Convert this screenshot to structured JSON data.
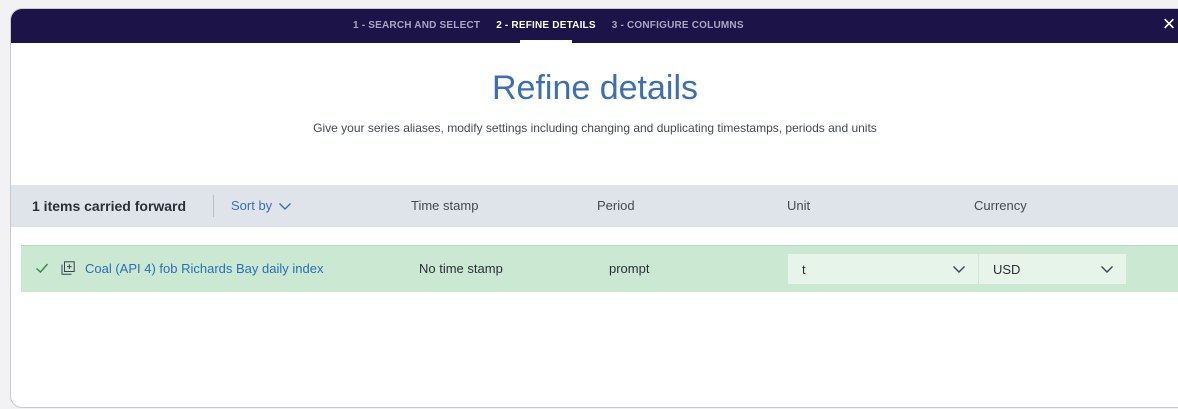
{
  "steps": [
    {
      "label": "1 - SEARCH AND SELECT",
      "active": false
    },
    {
      "label": "2 - REFINE DETAILS",
      "active": true
    },
    {
      "label": "3 - CONFIGURE COLUMNS",
      "active": false
    }
  ],
  "close_label": "×",
  "page": {
    "title": "Refine details",
    "subtitle": "Give your series aliases, modify settings including changing and duplicating timestamps, periods and units"
  },
  "header": {
    "carried": "1 items carried forward",
    "sort_label": "Sort by",
    "columns": {
      "timestamp": "Time stamp",
      "period": "Period",
      "unit": "Unit",
      "currency": "Currency"
    }
  },
  "row": {
    "series_name": "Coal (API 4) fob Richards Bay daily index",
    "timestamp": "No time stamp",
    "period": "prompt",
    "unit": "t",
    "currency": "USD"
  },
  "icons": {
    "check": "check-icon",
    "duplicate": "duplicate-icon",
    "chevron": "chevron-down-icon",
    "close": "close-icon"
  },
  "colors": {
    "topbar": "#1c1448",
    "accent": "#3a6fb5",
    "row_selected": "#cbe9d2",
    "header_bg": "#dfe3ea"
  }
}
